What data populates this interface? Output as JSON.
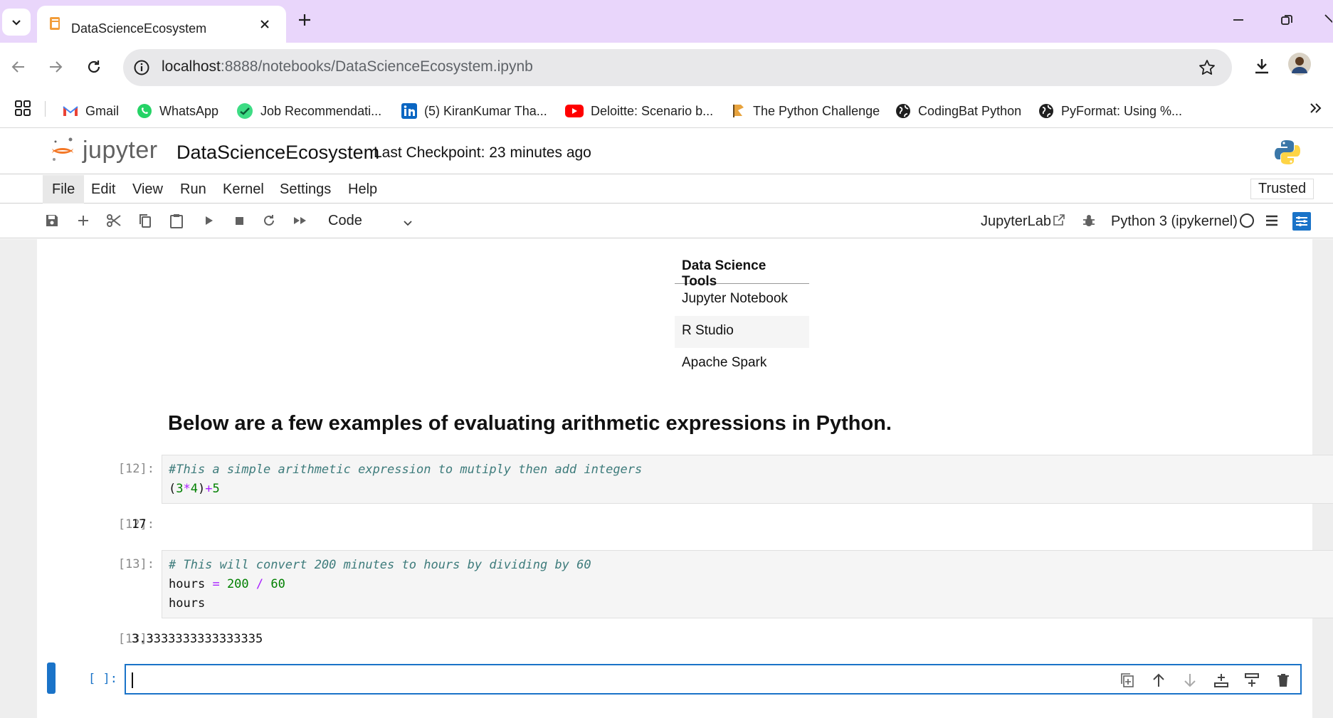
{
  "browser": {
    "tab_title": "DataScienceEcosystem",
    "url_host": "localhost",
    "url_rest": ":8888/notebooks/DataScienceEcosystem.ipynb",
    "bookmarks": [
      {
        "label": "Gmail",
        "icon": "gmail-icon"
      },
      {
        "label": "WhatsApp",
        "icon": "whatsapp-icon"
      },
      {
        "label": "Job Recommendati...",
        "icon": "job-icon"
      },
      {
        "label": "(5) KiranKumar Tha...",
        "icon": "linkedin-icon"
      },
      {
        "label": "Deloitte: Scenario b...",
        "icon": "youtube-icon"
      },
      {
        "label": "The Python Challenge",
        "icon": "python-challenge-icon"
      },
      {
        "label": "CodingBat Python",
        "icon": "globe-icon"
      },
      {
        "label": "PyFormat: Using %...",
        "icon": "globe-icon"
      }
    ]
  },
  "jupyter": {
    "logo_text": "jupyter",
    "notebook_title": "DataScienceEcosystem",
    "checkpoint": "Last Checkpoint: 23 minutes ago",
    "menus": [
      "File",
      "Edit",
      "View",
      "Run",
      "Kernel",
      "Settings",
      "Help"
    ],
    "trusted": "Trusted",
    "cell_type": "Code",
    "jupyterlab_label": "JupyterLab",
    "kernel_name": "Python 3 (ipykernel)"
  },
  "notebook": {
    "table": {
      "header": "Data Science Tools",
      "rows": [
        "Jupyter Notebook",
        "R Studio",
        "Apache Spark"
      ]
    },
    "heading": "Below are a few examples of evaluating arithmetic expressions in Python.",
    "cells": [
      {
        "prompt_in": "[12]:",
        "comment": "#This a simple arithmetic expression to mutiply then add integers",
        "line2": {
          "p1": "(",
          "n1": "3",
          "o1": "*",
          "n2": "4",
          "p2": ")",
          "o2": "+",
          "n3": "5"
        },
        "prompt_out": "[12]:",
        "output": "17"
      },
      {
        "prompt_in": "[13]:",
        "comment": "# This will convert 200 minutes to hours by dividing by 60",
        "line2": {
          "var": "hours",
          "eq": "=",
          "n1": "200",
          "div": "/",
          "n2": "60"
        },
        "line3": "hours",
        "prompt_out": "[13]:",
        "output": "3.3333333333333335"
      }
    ],
    "empty_prompt": "[ ]:"
  }
}
